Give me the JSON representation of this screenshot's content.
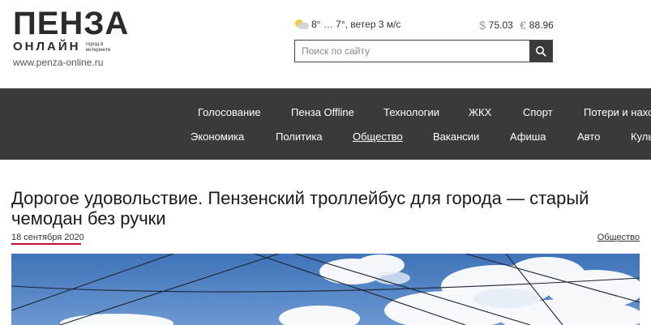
{
  "logo": {
    "title": "ПЕНЗА",
    "subtitle": "ОНЛАЙН",
    "slogan": "город в интернете",
    "url": "www.penza-online.ru"
  },
  "weather": {
    "icon": "partly-cloudy-icon",
    "text": "8° … 7°, ветер 3 м/с"
  },
  "rates": {
    "usd_symbol": "$",
    "usd": "75.03",
    "eur_symbol": "€",
    "eur": "88.96"
  },
  "search": {
    "placeholder": "Поиск по сайту",
    "icon": "search-icon"
  },
  "nav": {
    "row1": [
      "Голосование",
      "Пенза Offline",
      "Технологии",
      "ЖКХ",
      "Спорт",
      "Потери и находки"
    ],
    "row2": [
      "Экономика",
      "Политика",
      "Общество",
      "Вакансии",
      "Афиша",
      "Авто",
      "Культура"
    ],
    "active": "Общество"
  },
  "article": {
    "title": "Дорогое удовольствие. Пензенский троллейбус для города — старый чемодан без ручки",
    "date": "18 сентября 2020",
    "category": "Общество"
  },
  "colors": {
    "nav_bg": "#3a3a3a",
    "accent": "#c8102e",
    "sky": "#4d7fc0"
  }
}
